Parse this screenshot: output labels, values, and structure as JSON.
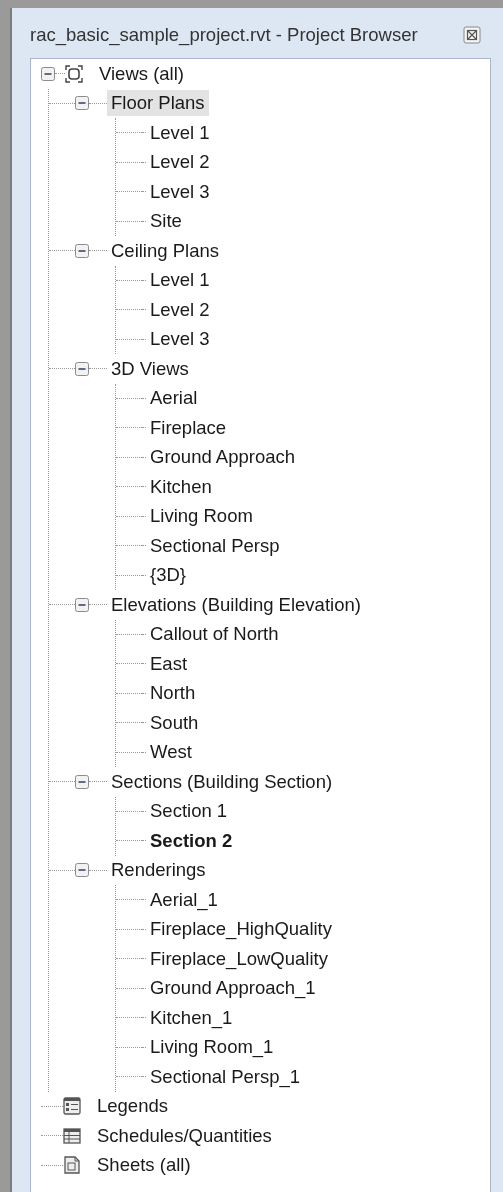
{
  "panel": {
    "title": "rac_basic_sample_project.rvt - Project Browser",
    "tree": [
      {
        "label": "Views (all)",
        "kind": "views",
        "expanded": true,
        "selected": false,
        "children": [
          {
            "label": "Floor Plans",
            "expanded": true,
            "selected": true,
            "children": [
              {
                "label": "Level 1",
                "selected": false,
                "current": false
              },
              {
                "label": "Level 2",
                "selected": false,
                "current": false
              },
              {
                "label": "Level 3",
                "selected": false,
                "current": false
              },
              {
                "label": "Site",
                "selected": false,
                "current": false
              }
            ]
          },
          {
            "label": "Ceiling Plans",
            "expanded": true,
            "selected": false,
            "children": [
              {
                "label": "Level 1",
                "selected": false,
                "current": false
              },
              {
                "label": "Level 2",
                "selected": false,
                "current": false
              },
              {
                "label": "Level 3",
                "selected": false,
                "current": false
              }
            ]
          },
          {
            "label": "3D Views",
            "expanded": true,
            "selected": false,
            "children": [
              {
                "label": "Aerial",
                "selected": false,
                "current": false
              },
              {
                "label": "Fireplace",
                "selected": false,
                "current": false
              },
              {
                "label": "Ground Approach",
                "selected": false,
                "current": false
              },
              {
                "label": "Kitchen",
                "selected": false,
                "current": false
              },
              {
                "label": "Living Room",
                "selected": false,
                "current": false
              },
              {
                "label": "Sectional Persp",
                "selected": false,
                "current": false
              },
              {
                "label": "{3D}",
                "selected": false,
                "current": false
              }
            ]
          },
          {
            "label": "Elevations (Building Elevation)",
            "expanded": true,
            "selected": false,
            "children": [
              {
                "label": "Callout of North",
                "selected": false,
                "current": false
              },
              {
                "label": "East",
                "selected": false,
                "current": false
              },
              {
                "label": "North",
                "selected": false,
                "current": false
              },
              {
                "label": "South",
                "selected": false,
                "current": false
              },
              {
                "label": "West",
                "selected": false,
                "current": false
              }
            ]
          },
          {
            "label": "Sections (Building Section)",
            "expanded": true,
            "selected": false,
            "children": [
              {
                "label": "Section 1",
                "selected": false,
                "current": false
              },
              {
                "label": "Section 2",
                "selected": false,
                "current": true
              }
            ]
          },
          {
            "label": "Renderings",
            "expanded": true,
            "selected": false,
            "children": [
              {
                "label": "Aerial_1",
                "selected": false,
                "current": false
              },
              {
                "label": "Fireplace_HighQuality",
                "selected": false,
                "current": false
              },
              {
                "label": "Fireplace_LowQuality",
                "selected": false,
                "current": false
              },
              {
                "label": "Ground Approach_1",
                "selected": false,
                "current": false
              },
              {
                "label": "Kitchen_1",
                "selected": false,
                "current": false
              },
              {
                "label": "Living Room_1",
                "selected": false,
                "current": false
              },
              {
                "label": "Sectional Persp_1",
                "selected": false,
                "current": false
              }
            ]
          }
        ]
      },
      {
        "label": "Legends",
        "kind": "legends",
        "selected": false
      },
      {
        "label": "Schedules/Quantities",
        "kind": "schedules",
        "selected": false
      },
      {
        "label": "Sheets (all)",
        "kind": "sheets",
        "selected": false
      }
    ]
  }
}
